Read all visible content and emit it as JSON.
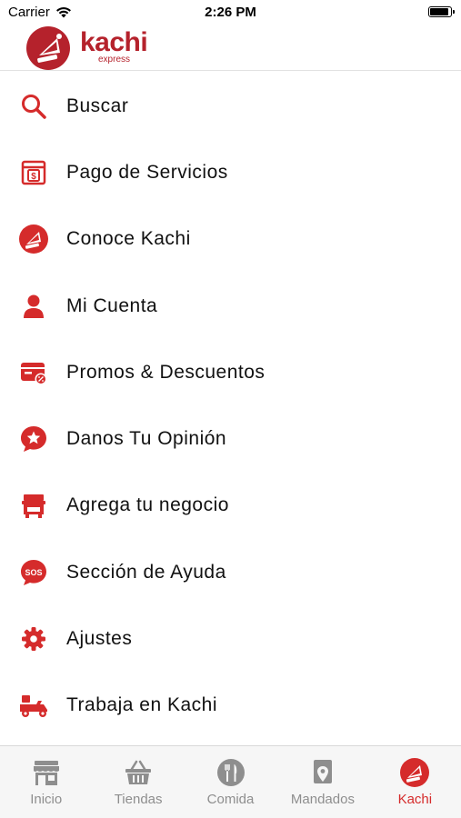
{
  "status_bar": {
    "carrier": "Carrier",
    "time": "2:26 PM"
  },
  "header": {
    "brand": "kachi",
    "tagline": "express"
  },
  "colors": {
    "accent": "#d52b2b",
    "brand_dark": "#b5222c",
    "tab_inactive": "#8e8e8e"
  },
  "menu": [
    {
      "label": "Buscar",
      "icon": "search-icon"
    },
    {
      "label": "Pago de Servicios",
      "icon": "bill-payment-icon"
    },
    {
      "label": "Conoce Kachi",
      "icon": "kachi-logo-icon"
    },
    {
      "label": "Mi Cuenta",
      "icon": "user-icon"
    },
    {
      "label": "Promos & Descuentos",
      "icon": "promo-icon"
    },
    {
      "label": "Danos Tu Opinión",
      "icon": "feedback-star-icon"
    },
    {
      "label": "Agrega tu negocio",
      "icon": "store-icon"
    },
    {
      "label": "Sección de Ayuda",
      "icon": "sos-icon"
    },
    {
      "label": "Ajustes",
      "icon": "gear-icon"
    },
    {
      "label": "Trabaja en Kachi",
      "icon": "delivery-scooter-icon"
    }
  ],
  "sos_text": "SOS",
  "tabs": [
    {
      "label": "Inicio",
      "icon": "storefront-icon",
      "active": false
    },
    {
      "label": "Tiendas",
      "icon": "basket-icon",
      "active": false
    },
    {
      "label": "Comida",
      "icon": "fork-knife-icon",
      "active": false
    },
    {
      "label": "Mandados",
      "icon": "map-pin-icon",
      "active": false
    },
    {
      "label": "Kachi",
      "icon": "kachi-logo-icon",
      "active": true
    }
  ]
}
